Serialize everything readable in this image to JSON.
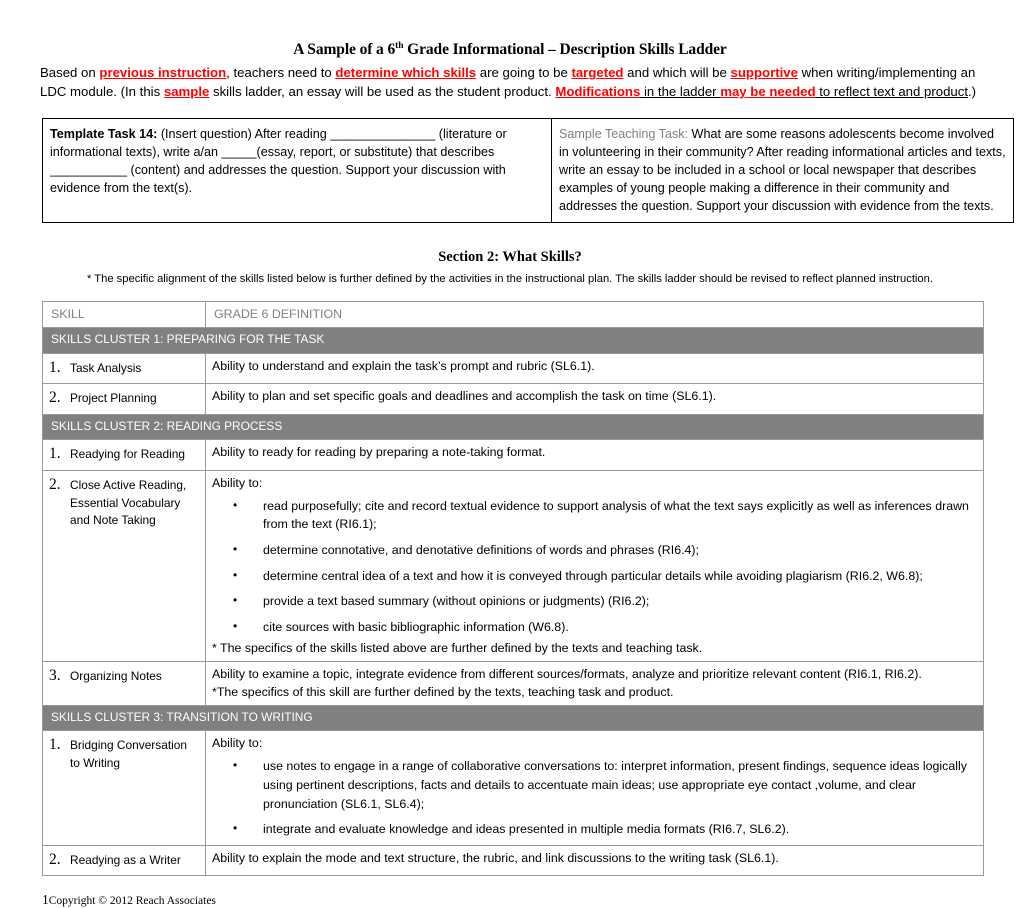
{
  "document": {
    "title_pre": "A Sample of a 6",
    "title_sup": "th",
    "title_post": " Grade Informational – Description Skills Ladder",
    "intro": {
      "s1": "Based on ",
      "r1": "previous instruction",
      "s2": ", teachers need to ",
      "r2": "determine which skills",
      "s3": " are going to be ",
      "r3": "targeted",
      "s4": " and which will be ",
      "r4": "supportive",
      "s5": " when writing/implementing an LDC module.  (In this ",
      "r5": "sample",
      "s6": " skills ladder, an essay will be used as the student product.  ",
      "r6": "Modifications",
      "u1": " in the ladder ",
      "r7": "may be needed",
      "u2": " to reflect text and product",
      "s7": ".)"
    }
  },
  "template_task": {
    "left_label": "Template Task 14:",
    "left_body": " (Insert question) After reading _______________ (literature or informational texts), write a/an _____(essay, report, or substitute) that describes ___________ (content) and addresses the question.   Support your discussion with evidence from the text(s).",
    "right_label": "Sample Teaching Task:",
    "right_body": "  What are some reasons adolescents become involved in volunteering in their community? After reading informational articles and texts, write an essay to be included in a school or local newspaper that describes examples of young people making a difference in their community and addresses the question.  Support your discussion with evidence from the texts."
  },
  "section": {
    "heading": "Section 2: What Skills?",
    "subheading": "* The specific alignment of the skills listed below is further defined by the activities in the instructional plan. The skills ladder should be revised to reflect planned instruction."
  },
  "skills_table": {
    "headers": {
      "skill": "SKILL",
      "definition": "GRADE 6 DEFINITION"
    },
    "clusters": [
      {
        "title": "SKILLS CLUSTER 1: PREPARING FOR THE TASK",
        "rows": [
          {
            "num": "1.",
            "name": "Task Analysis",
            "definition": "Ability to understand and explain the task’s prompt and rubric (SL6.1)."
          },
          {
            "num": "2.",
            "name": "Project Planning",
            "definition": "Ability to plan and set specific goals and deadlines and accomplish the task on time (SL6.1)."
          }
        ]
      },
      {
        "title": "SKILLS CLUSTER 2: READING PROCESS",
        "rows": [
          {
            "num": "1.",
            "name": "Readying for Reading",
            "definition": "Ability to ready for reading by preparing a note-taking format."
          },
          {
            "num": "2.",
            "name": "Close Active Reading, Essential Vocabulary and Note Taking",
            "lead": "Ability to:",
            "bullets": [
              "read purposefully; cite and record textual evidence to support analysis of what the text says explicitly as well as inferences drawn from the text (RI6.1);",
              "determine connotative, and denotative definitions of words and phrases (RI6.4);",
              "determine central idea of a text and how it is conveyed through particular details while avoiding plagiarism (RI6.2, W6.8);",
              "provide a text based summary (without opinions or judgments) (RI6.2);",
              " cite sources with basic bibliographic information (W6.8)."
            ],
            "note": "* The specifics of the skills listed above are further defined by the texts and teaching task."
          },
          {
            "num": "3.",
            "name": "Organizing Notes",
            "definition": "Ability to examine a topic, integrate evidence from different sources/formats, analyze and prioritize relevant content (RI6.1, RI6.2).",
            "note": "*The specifics of this skill are further defined by the texts, teaching task and product."
          }
        ]
      },
      {
        "title": "SKILLS CLUSTER 3: TRANSITION TO WRITING",
        "rows": [
          {
            "num": "1.",
            "name": "Bridging Conversation to Writing",
            "lead": "Ability to:",
            "bullets": [
              "use notes to engage in a range of collaborative conversations to: interpret information, present findings, sequence ideas logically using pertinent descriptions, facts and details to accentuate main ideas; use appropriate eye contact ,volume, and clear pronunciation (SL6.1, SL6.4);",
              "integrate and evaluate knowledge and ideas presented in multiple media formats (RI6.7, SL6.2)."
            ]
          },
          {
            "num": "2.",
            "name": "Readying as a Writer",
            "definition": "Ability to explain the mode and text structure, the rubric, and link discussions to the writing task (SL6.1)."
          }
        ]
      }
    ]
  },
  "footer": {
    "page_number": "1",
    "copyright": "Copyright © 2012 Reach Associates"
  }
}
